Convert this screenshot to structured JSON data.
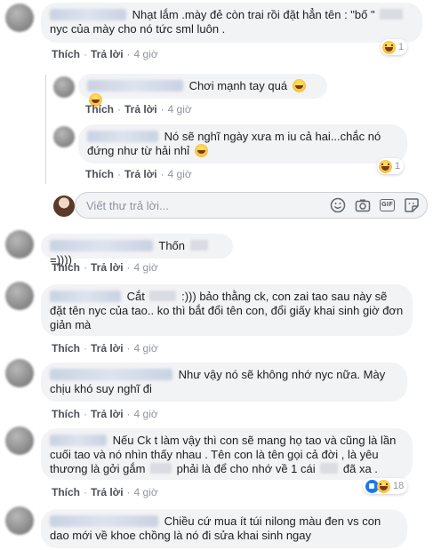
{
  "comments": [
    {
      "text_before": "Nhạt lắm .mày đẻ còn trai rồi đặt hẳn tên : \"bố \"",
      "text_after": "nyc của mày cho nó tức sml luôn .",
      "like_label": "Thích",
      "reply_label": "Trả lời",
      "time": "4 giờ",
      "reaction_count": "1"
    },
    {
      "text": "Chơi mạnh tay quá",
      "like_label": "Thích",
      "reply_label": "Trả lời",
      "time": "4 giờ"
    },
    {
      "text": "Nó sẽ nghĩ ngày xưa m iu cả hai...chắc nó đứng như từ hải nhỉ",
      "like_label": "Thích",
      "reply_label": "Trả lời",
      "time": "4 giờ",
      "reaction_count": "1"
    },
    {
      "text_before": "Thốn",
      "text_after": "=))))",
      "like_label": "Thích",
      "reply_label": "Trả lời",
      "time": "4 giờ"
    },
    {
      "text_before": "Cắt",
      "text_after": ":))) bảo thằng ck, con zai tao sau này sẽ đặt tên nyc của tao.. ko thì bắt đổi tên con, đổi giấy khai sinh giờ đơn giản mà",
      "like_label": "Thích",
      "reply_label": "Trả lời",
      "time": "4 giờ"
    },
    {
      "text": "Như vậy nó sẽ không nhớ nyc nữa. Mày chịu khó suy nghĩ đi",
      "like_label": "Thích",
      "reply_label": "Trả lời",
      "time": "4 giờ"
    },
    {
      "text_1": "Nếu Ck t làm vậy thì con sẽ mang họ tao và cũng là lần cuối tao và nó nhìn thấy nhau . Tên con là tên gọi cả đời , là yêu thương là gởi gắm",
      "text_2": "phải là để cho nhớ về 1 cái",
      "text_3": "đã xa .",
      "like_label": "Thích",
      "reply_label": "Trả lời",
      "time": "4 giờ",
      "reaction_count": "18"
    },
    {
      "text": "Chiều cứ mua ít túi nilong màu đen vs con dao mới về khoe chồng là nó đi sửa khai sinh ngay"
    }
  ],
  "reply_box": {
    "placeholder": "Viết thư trả lời..."
  },
  "icons": [
    "haha-icon",
    "like-icon",
    "emoji-icon",
    "camera-icon",
    "gif-icon",
    "sticker-icon"
  ],
  "colors": {
    "bubble": "#f2f3f5",
    "action_link": "#4b4f56",
    "meta_text": "#90949c",
    "like_blue": "#1877f2"
  }
}
